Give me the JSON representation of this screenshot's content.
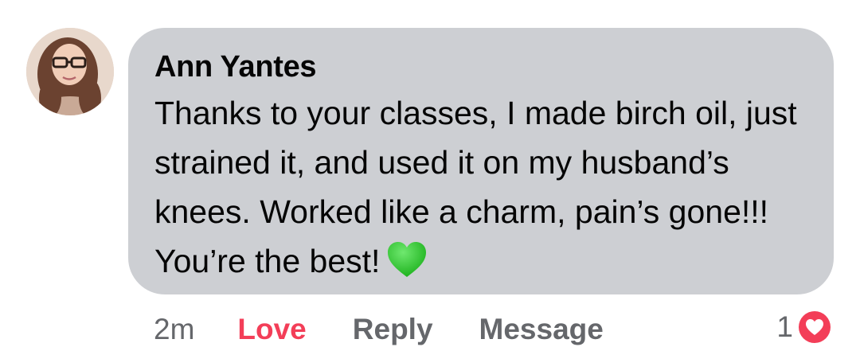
{
  "comment": {
    "author": "Ann Yantes",
    "text": "Thanks to your classes, I made birch oil, just strained it, and used it on my husband’s knees. Worked like a charm, pain’s gone!!! You’re the best!",
    "emoji_icon": "green-heart-icon"
  },
  "actions": {
    "time": "2m",
    "love_label": "Love",
    "reply_label": "Reply",
    "message_label": "Message"
  },
  "reactions": {
    "count": "1",
    "icon": "love-reaction-icon"
  },
  "colors": {
    "bubble": "#cdcfd3",
    "love": "#f33e58",
    "meta_text": "#65676b",
    "emoji_green": "#2ecc2e"
  }
}
